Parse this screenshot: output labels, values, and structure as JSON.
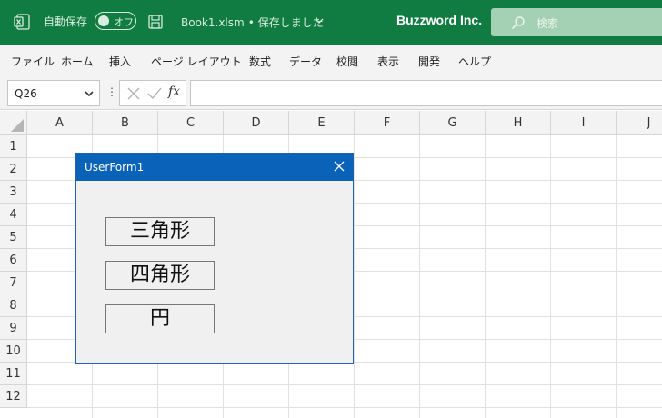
{
  "titlebar": {
    "autosave_label": "自動保存",
    "autosave_state": "オフ",
    "file_name": "Book1.xlsm",
    "dot": "•",
    "save_status": "保存しました",
    "company": "Buzzword Inc.",
    "search_placeholder": "検索",
    "bg_color": "#107c41"
  },
  "menu": {
    "items": [
      "ファイル",
      "ホーム",
      "挿入",
      "ページ レイアウト",
      "数式",
      "データ",
      "校閲",
      "表示",
      "開発",
      "ヘルプ"
    ]
  },
  "formula_bar": {
    "name_box": "Q26",
    "separator": "⋮",
    "fx_label": "fx",
    "formula": ""
  },
  "sheet": {
    "columns": [
      "A",
      "B",
      "C",
      "D",
      "E",
      "F",
      "G",
      "H",
      "I",
      "J"
    ],
    "rows": [
      "1",
      "2",
      "3",
      "4",
      "5",
      "6",
      "7",
      "8",
      "9",
      "10",
      "11",
      "12"
    ]
  },
  "userform": {
    "title": "UserForm1",
    "title_color": "#0a63b8",
    "buttons": [
      "三角形",
      "四角形",
      "円"
    ]
  }
}
